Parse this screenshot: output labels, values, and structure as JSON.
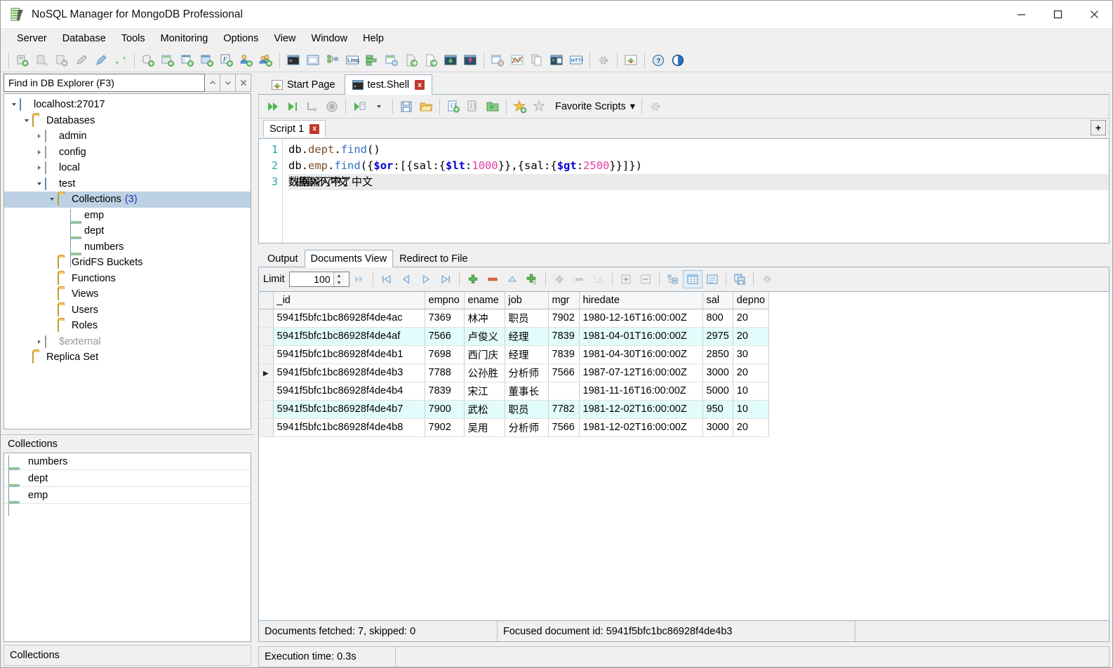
{
  "window": {
    "title": "NoSQL Manager for MongoDB Professional",
    "icon": "app-icon",
    "minimize": "—",
    "maximize": "□",
    "close": "✕"
  },
  "menubar": {
    "items": [
      "Server",
      "Database",
      "Tools",
      "Monitoring",
      "Options",
      "View",
      "Window",
      "Help"
    ]
  },
  "toolbar": {
    "groups": [
      [
        "connect-icon",
        "disconnect-icon",
        "remove-connection-icon",
        "edit-connection-icon",
        "new-connection-icon",
        "refresh-icon"
      ],
      [
        "new-database-icon",
        "new-collection-icon",
        "new-view-icon",
        "new-capped-collection-icon",
        "new-function-icon",
        "new-user-icon",
        "new-role-icon"
      ],
      [
        "shell-icon",
        "document-window-icon",
        "tree-view-icon",
        "linq-icon",
        "aggregate-icon",
        "sql-query-icon",
        "import-icon",
        "export-icon",
        "backup-icon",
        "restore-icon"
      ],
      [
        "index-manager-icon",
        "chart-icon",
        "duplicate-icon",
        "console-icon",
        "http-icon"
      ],
      [
        "options-icon"
      ],
      [
        "start-page-icon"
      ],
      [
        "help-icon",
        "about-icon"
      ]
    ]
  },
  "explorer": {
    "search": {
      "value": "Find in DB Explorer (F3)",
      "placeholder": "Find in DB Explorer (F3)"
    },
    "nav": {
      "prev": "⌃",
      "next": "⌄",
      "close": "✕"
    },
    "tree": [
      {
        "label": "localhost:27017",
        "icon": "server-icon",
        "indent": 0,
        "twisty": "expanded",
        "selected": false,
        "dim": false
      },
      {
        "label": "Databases",
        "icon": "folder-icon",
        "indent": 1,
        "twisty": "expanded",
        "selected": false,
        "dim": false
      },
      {
        "label": "admin",
        "icon": "database-icon",
        "indent": 2,
        "twisty": "collapsed",
        "selected": false,
        "dim": false
      },
      {
        "label": "config",
        "icon": "database-icon",
        "indent": 2,
        "twisty": "collapsed",
        "selected": false,
        "dim": false
      },
      {
        "label": "local",
        "icon": "database-icon",
        "indent": 2,
        "twisty": "collapsed",
        "selected": false,
        "dim": false
      },
      {
        "label": "test",
        "icon": "database-active-icon",
        "indent": 2,
        "twisty": "expanded",
        "selected": false,
        "dim": false
      },
      {
        "label": "Collections",
        "count": "(3)",
        "icon": "folder-icon",
        "indent": 3,
        "twisty": "expanded",
        "selected": true,
        "dim": false
      },
      {
        "label": "emp",
        "icon": "collection-icon",
        "indent": 4,
        "twisty": "none",
        "selected": false,
        "dim": false
      },
      {
        "label": "dept",
        "icon": "collection-icon",
        "indent": 4,
        "twisty": "none",
        "selected": false,
        "dim": false
      },
      {
        "label": "numbers",
        "icon": "collection-icon",
        "indent": 4,
        "twisty": "none",
        "selected": false,
        "dim": false
      },
      {
        "label": "GridFS Buckets",
        "icon": "folder-icon",
        "indent": 3,
        "twisty": "none",
        "selected": false,
        "dim": false
      },
      {
        "label": "Functions",
        "icon": "folder-icon",
        "indent": 3,
        "twisty": "none",
        "selected": false,
        "dim": false
      },
      {
        "label": "Views",
        "icon": "folder-icon",
        "indent": 3,
        "twisty": "none",
        "selected": false,
        "dim": false
      },
      {
        "label": "Users",
        "icon": "folder-icon",
        "indent": 3,
        "twisty": "none",
        "selected": false,
        "dim": false
      },
      {
        "label": "Roles",
        "icon": "folder-icon",
        "indent": 3,
        "twisty": "none",
        "selected": false,
        "dim": false
      },
      {
        "label": "$external",
        "icon": "database-icon",
        "indent": 2,
        "twisty": "collapsed",
        "selected": false,
        "dim": true
      },
      {
        "label": "Replica Set",
        "icon": "folder-icon",
        "indent": 1,
        "twisty": "none",
        "selected": false,
        "dim": false
      }
    ]
  },
  "collections_panel": {
    "header": "Collections",
    "items": [
      {
        "label": "numbers",
        "icon": "collection-icon"
      },
      {
        "label": "dept",
        "icon": "collection-icon"
      },
      {
        "label": "emp",
        "icon": "collection-icon"
      }
    ]
  },
  "left_status": "Collections",
  "doc_tabs": [
    {
      "label": "Start Page",
      "icon": "start-page-icon",
      "active": false,
      "closable": false
    },
    {
      "label": "test.Shell",
      "icon": "shell-icon",
      "active": true,
      "closable": true,
      "close": "x"
    }
  ],
  "shell_toolbar": {
    "buttons": [
      "execute-all-icon",
      "execute-current-icon",
      "execute-to-cursor-icon",
      "stop-icon",
      "execute-options-icon",
      "save-script-icon",
      "open-script-icon",
      "new-script-icon",
      "copy-script-icon",
      "open-folder-icon",
      "add-favorite-icon",
      "remove-favorite-icon"
    ],
    "favorite_scripts_label": "Favorite Scripts",
    "dropdown_caret": "▾",
    "settings_icon": "gear-icon"
  },
  "script_tabs": {
    "tabs": [
      {
        "label": "Script 1",
        "close": "x",
        "active": true
      }
    ],
    "add_button": "+"
  },
  "editor": {
    "lines": [
      {
        "num": "1",
        "tokens": [
          {
            "t": "db",
            "c": "obj"
          },
          {
            "t": ".",
            "c": "obj"
          },
          {
            "t": "dept",
            "c": "prop"
          },
          {
            "t": ".",
            "c": "obj"
          },
          {
            "t": "find",
            "c": "fn"
          },
          {
            "t": "()",
            "c": "obj"
          }
        ]
      },
      {
        "num": "2",
        "tokens": [
          {
            "t": "db",
            "c": "obj"
          },
          {
            "t": ".",
            "c": "obj"
          },
          {
            "t": "emp",
            "c": "prop"
          },
          {
            "t": ".",
            "c": "obj"
          },
          {
            "t": "find",
            "c": "fn"
          },
          {
            "t": "({",
            "c": "obj"
          },
          {
            "t": "$or",
            "c": "op"
          },
          {
            "t": ":[{sal:{",
            "c": "obj"
          },
          {
            "t": "$lt",
            "c": "op"
          },
          {
            "t": ":",
            "c": "obj"
          },
          {
            "t": "1000",
            "c": "num"
          },
          {
            "t": "}},{sal:{",
            "c": "obj"
          },
          {
            "t": "$gt",
            "c": "op"
          },
          {
            "t": ":",
            "c": "obj"
          },
          {
            "t": "2500",
            "c": "num"
          },
          {
            "t": "}}]})",
            "c": "obj"
          }
        ]
      },
      {
        "num": "3",
        "cjk": [
          "数据输入不了中文",
          "数据输入不了中文"
        ],
        "current": true
      }
    ]
  },
  "result_tabs": [
    {
      "label": "Output",
      "active": false
    },
    {
      "label": "Documents View",
      "active": true
    },
    {
      "label": "Redirect to File",
      "active": false
    }
  ],
  "grid_toolbar": {
    "limit_label": "Limit",
    "limit_value": "100",
    "spin_up": "▲",
    "spin_down": "▼",
    "buttons": [
      "fetch-more-icon",
      "first-page-icon",
      "prev-page-icon",
      "next-page-icon",
      "last-page-icon",
      "add-document-icon",
      "delete-document-icon",
      "edit-document-icon",
      "clone-document-icon",
      "add-field-icon",
      "delete-field-icon",
      "edit-field-icon",
      "expand-all-icon",
      "collapse-all-icon",
      "tree-view-icon",
      "table-view-icon",
      "json-view-icon",
      "split-view-icon",
      "grid-settings-icon"
    ]
  },
  "grid": {
    "columns": [
      "_id",
      "empno",
      "ename",
      "job",
      "mgr",
      "hiredate",
      "sal",
      "depno"
    ],
    "rows": [
      {
        "marker": "",
        "alt": false,
        "cells": [
          "5941f5bfc1bc86928f4de4ac",
          "7369",
          "林冲",
          "职员",
          "7902",
          "1980-12-16T16:00:00Z",
          "800",
          "20"
        ]
      },
      {
        "marker": "",
        "alt": true,
        "cells": [
          "5941f5bfc1bc86928f4de4af",
          "7566",
          "卢俊义",
          "经理",
          "7839",
          "1981-04-01T16:00:00Z",
          "2975",
          "20"
        ]
      },
      {
        "marker": "",
        "alt": false,
        "cells": [
          "5941f5bfc1bc86928f4de4b1",
          "7698",
          "西门庆",
          "经理",
          "7839",
          "1981-04-30T16:00:00Z",
          "2850",
          "30"
        ]
      },
      {
        "marker": "▶",
        "alt": false,
        "cells": [
          "5941f5bfc1bc86928f4de4b3",
          "7788",
          "公孙胜",
          "分析师",
          "7566",
          "1987-07-12T16:00:00Z",
          "3000",
          "20"
        ]
      },
      {
        "marker": "",
        "alt": false,
        "cells": [
          "5941f5bfc1bc86928f4de4b4",
          "7839",
          "宋江",
          "董事长",
          "",
          "1981-11-16T16:00:00Z",
          "5000",
          "10"
        ]
      },
      {
        "marker": "",
        "alt": true,
        "cells": [
          "5941f5bfc1bc86928f4de4b7",
          "7900",
          "武松",
          "职员",
          "7782",
          "1981-12-02T16:00:00Z",
          "950",
          "10"
        ]
      },
      {
        "marker": "",
        "alt": false,
        "cells": [
          "5941f5bfc1bc86928f4de4b8",
          "7902",
          "吴用",
          "分析师",
          "7566",
          "1981-12-02T16:00:00Z",
          "3000",
          "20"
        ]
      }
    ]
  },
  "grid_status": {
    "fetched": "Documents fetched: 7, skipped: 0",
    "focused": "Focused document id: 5941f5bfc1bc86928f4de4b3",
    "extra": ""
  },
  "exec_status": {
    "time": "Execution time: 0.3s",
    "extra": ""
  },
  "colors": {
    "accent": "#2f6fbf",
    "alt_row": "#e2fcfc",
    "selection": "#bcd2e4",
    "gutter_text": "#2a9fa8",
    "operator": "#0000d0",
    "number": "#e040a0",
    "property": "#7b4f2c",
    "close_badge": "#c0392b"
  }
}
